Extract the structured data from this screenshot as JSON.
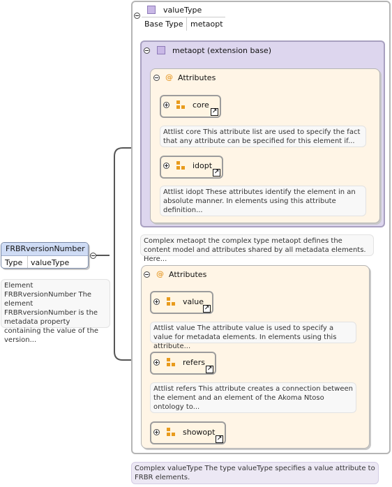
{
  "root_element": {
    "name": "FRBRversionNumber",
    "type_label": "Type",
    "type_value": "valueType",
    "note": "Element FRBRversionNumber The element FRBRversionNumber is the metadata property containing the value of the version..."
  },
  "value_type": {
    "title": "valueType",
    "base_type_label": "Base Type",
    "base_type_value": "metaopt",
    "note": "Complex valueType The type valueType specifies a value attribute to FRBR elements."
  },
  "metaopt": {
    "title": "metaopt (extension base)",
    "note": "Complex metaopt the complex type metaopt defines the content model and attributes shared by all metadata elements. Here...",
    "attributes_label": "Attributes",
    "items": [
      {
        "name": "core",
        "note": "Attlist core This attribute list are used to specify the fact that any attribute can be specified for this element if..."
      },
      {
        "name": "idopt",
        "note": "Attlist idopt These attributes identify the element in an absolute manner. In elements using this attribute definition..."
      }
    ]
  },
  "value_attributes": {
    "attributes_label": "Attributes",
    "items": [
      {
        "name": "value",
        "note": "Attlist value The attribute value is used to specify a value for metadata elements. In elements using this attribute..."
      },
      {
        "name": "refers",
        "note": "Attlist refers This attribute creates a connection between the element and an element of the Akoma Ntoso ontology to..."
      },
      {
        "name": "showopt",
        "note": ""
      }
    ]
  },
  "icons": {
    "expand": "plus-circle-icon",
    "collapse": "minus-circle-icon",
    "reference": "link-arrow-icon",
    "attribute_group": "attribute-group-icon",
    "complex_type": "complex-type-icon",
    "attribute_marker": "@"
  },
  "colors": {
    "group_fill": "#fff5e6",
    "outer_border": "#b5b5b5",
    "purple_panel": "#ddd6ee",
    "header_blue": "#cfdcf5"
  }
}
